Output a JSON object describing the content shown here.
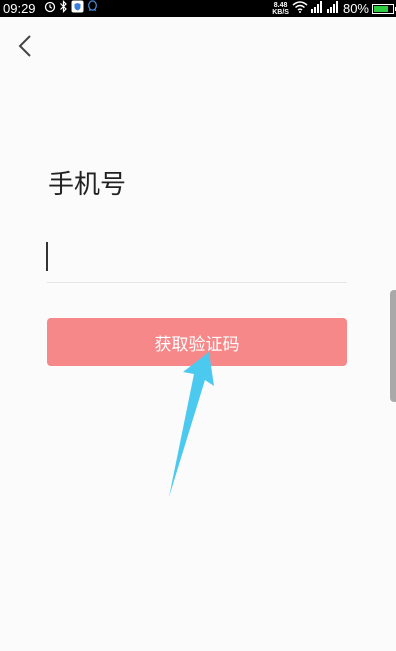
{
  "status_bar": {
    "time": "09:29",
    "net_speed_value": "8.48",
    "net_speed_unit": "KB/S",
    "battery_percent": "80%",
    "battery_level": 0.8,
    "icons": [
      "alarm-icon",
      "bluetooth-icon",
      "shield-app-icon",
      "qq-icon",
      "wifi-icon",
      "signal-icon",
      "battery-icon"
    ]
  },
  "nav": {
    "back_icon": "chevron-left-icon"
  },
  "form": {
    "title": "手机号",
    "phone_value": "",
    "submit_label": "获取验证码"
  },
  "colors": {
    "button": "#f6888a",
    "annotation_arrow": "#4cc9ef",
    "background": "#fbfbfb"
  }
}
